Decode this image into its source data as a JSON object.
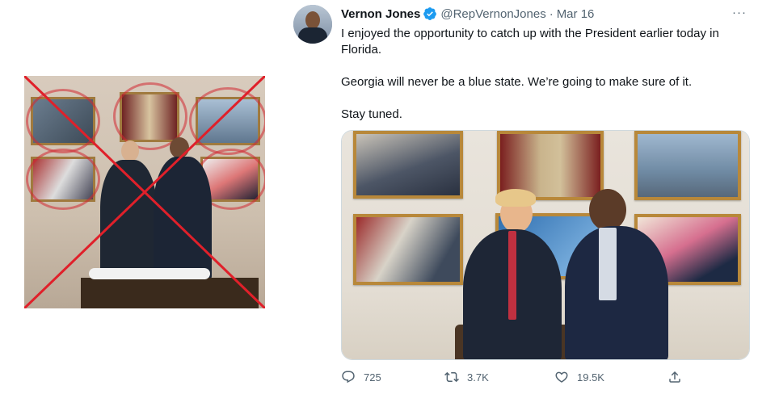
{
  "tweet": {
    "author_name": "Vernon Jones",
    "handle": "@RepVernonJones",
    "separator": "·",
    "date": "Mar 16",
    "more_label": "···",
    "paragraphs": [
      "I enjoyed the opportunity to catch up with the President earlier today in Florida.",
      "Georgia will never be a blue state. We’re going to make sure of it.",
      "Stay tuned."
    ],
    "stats": {
      "replies": "725",
      "retweets": "3.7K",
      "likes": "19.5K"
    }
  },
  "colors": {
    "verified": "#1d9bf0",
    "cross": "#e0202a",
    "secondary_text": "#536471"
  },
  "icons": [
    "verified-icon",
    "more-icon",
    "reply-icon",
    "retweet-icon",
    "like-icon",
    "share-icon"
  ]
}
